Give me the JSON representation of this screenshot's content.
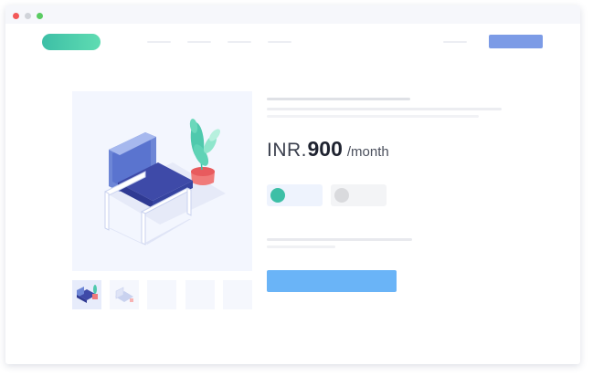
{
  "window": {
    "traffic_lights": [
      "close",
      "minimize",
      "maximize"
    ]
  },
  "header": {
    "logo": "brand-logo",
    "nav_links": [
      "nav-link-1",
      "nav-link-2",
      "nav-link-3",
      "nav-link-4"
    ],
    "account_link": "account-link"
  },
  "product": {
    "image": "armchair-with-plant-illustration",
    "thumbnails": 5,
    "selected_thumbnail": 1,
    "price": {
      "currency": "INR",
      "amount": "900",
      "period": "/month"
    },
    "options": [
      "teal",
      "grey"
    ],
    "selected_option": 1
  },
  "colors": {
    "accent": "#7c9be6",
    "buy_button": "#6ab4f7",
    "logo_gradient": [
      "#3dbfa6",
      "#5fdcb2"
    ],
    "teal_option": "#3dbfa6",
    "grey_option": "#d9dadd",
    "placeholder_line": "#e8e9ee"
  }
}
